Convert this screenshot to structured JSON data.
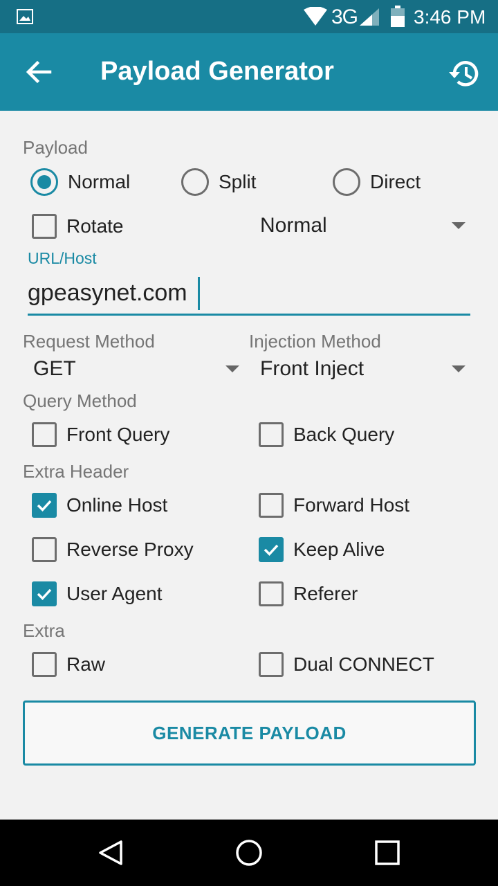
{
  "status": {
    "icons": [
      "image-icon",
      "wifi-icon",
      "signal-icon",
      "battery-icon"
    ],
    "network": "3G",
    "time": "3:46 PM"
  },
  "appbar": {
    "title": "Payload Generator",
    "back_icon": "arrow-back-icon",
    "history_icon": "history-icon"
  },
  "payload": {
    "section_label": "Payload",
    "modes": [
      {
        "label": "Normal",
        "selected": true
      },
      {
        "label": "Split",
        "selected": false
      },
      {
        "label": "Direct",
        "selected": false
      }
    ],
    "rotate": {
      "label": "Rotate",
      "checked": false
    },
    "rotate_mode": "Normal"
  },
  "url_host": {
    "label": "URL/Host",
    "value": "gpeasynet.com"
  },
  "request_method": {
    "label": "Request Method",
    "value": "GET"
  },
  "injection_method": {
    "label": "Injection Method",
    "value": "Front Inject"
  },
  "query_method": {
    "label": "Query Method",
    "options": [
      {
        "label": "Front Query",
        "checked": false
      },
      {
        "label": "Back Query",
        "checked": false
      }
    ]
  },
  "extra_header": {
    "label": "Extra Header",
    "options": [
      {
        "label": "Online Host",
        "checked": true
      },
      {
        "label": "Forward Host",
        "checked": false
      },
      {
        "label": "Reverse Proxy",
        "checked": false
      },
      {
        "label": "Keep Alive",
        "checked": true
      },
      {
        "label": "User Agent",
        "checked": true
      },
      {
        "label": "Referer",
        "checked": false
      }
    ]
  },
  "extra": {
    "label": "Extra",
    "options": [
      {
        "label": "Raw",
        "checked": false
      },
      {
        "label": "Dual CONNECT",
        "checked": false
      }
    ]
  },
  "generate_button": "GENERATE PAYLOAD",
  "colors": {
    "accent": "#1a8aa4",
    "status_bar": "#166f85",
    "background": "#f2f2f2"
  }
}
